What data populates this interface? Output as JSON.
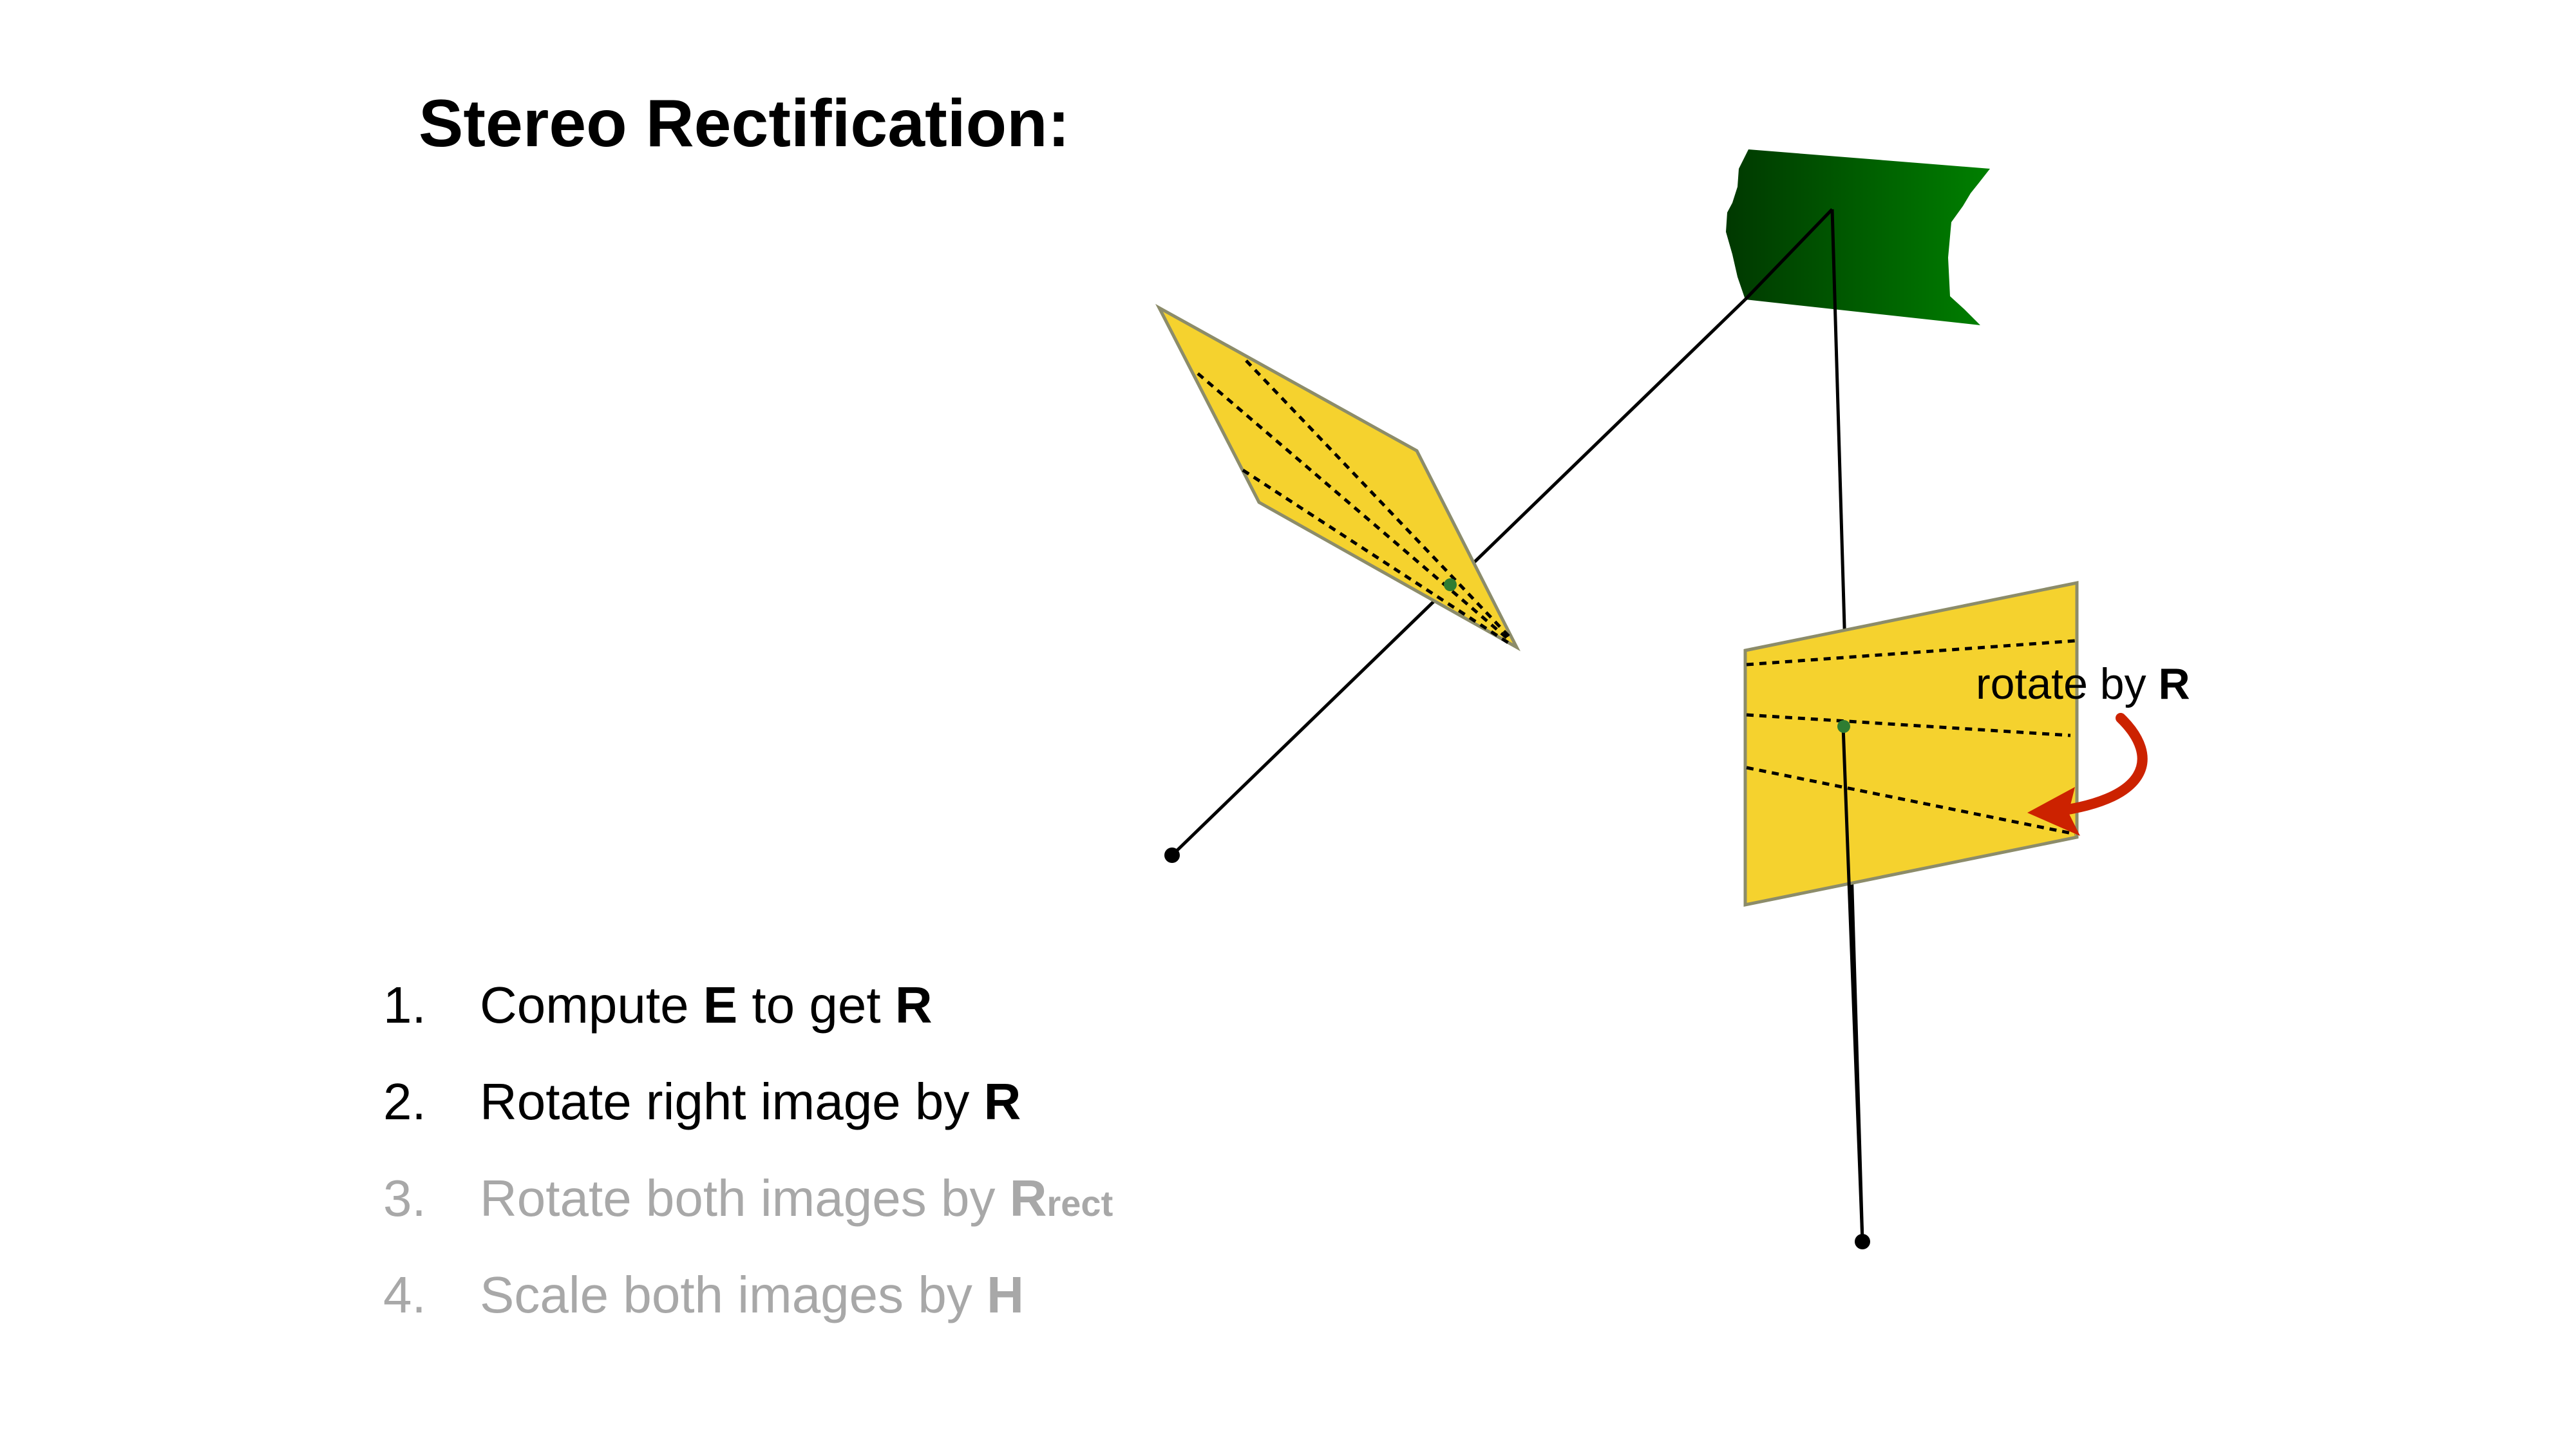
{
  "title": "Stereo Rectification:",
  "diagram": {
    "rotate_label": "rotate by ",
    "rotate_symbol": "R"
  },
  "steps": [
    {
      "number": "1.",
      "parts": [
        {
          "text": "Compute ",
          "bold": false
        },
        {
          "text": "E",
          "bold": true
        },
        {
          "text": " to get ",
          "bold": false
        },
        {
          "text": "R",
          "bold": true
        }
      ],
      "active": true
    },
    {
      "number": "2.",
      "parts": [
        {
          "text": "Rotate right image by ",
          "bold": false
        },
        {
          "text": "R",
          "bold": true
        }
      ],
      "active": true
    },
    {
      "number": "3.",
      "parts": [
        {
          "text": "Rotate both images by ",
          "bold": false
        },
        {
          "text": "R",
          "bold": true
        },
        {
          "text": "rect",
          "bold": true,
          "sub": true
        }
      ],
      "active": false
    },
    {
      "number": "4.",
      "parts": [
        {
          "text": "Scale both images by ",
          "bold": false
        },
        {
          "text": "H",
          "bold": true
        }
      ],
      "active": false
    }
  ],
  "colors": {
    "image_plane": "#f5d22e",
    "plane_edge": "#8c8c6a",
    "object_dark": "#003800",
    "object_light": "#008000",
    "arrow": "#cc2200",
    "dim_text": "#a8a8a8"
  },
  "icons": [
    "curved-arrow-icon"
  ]
}
